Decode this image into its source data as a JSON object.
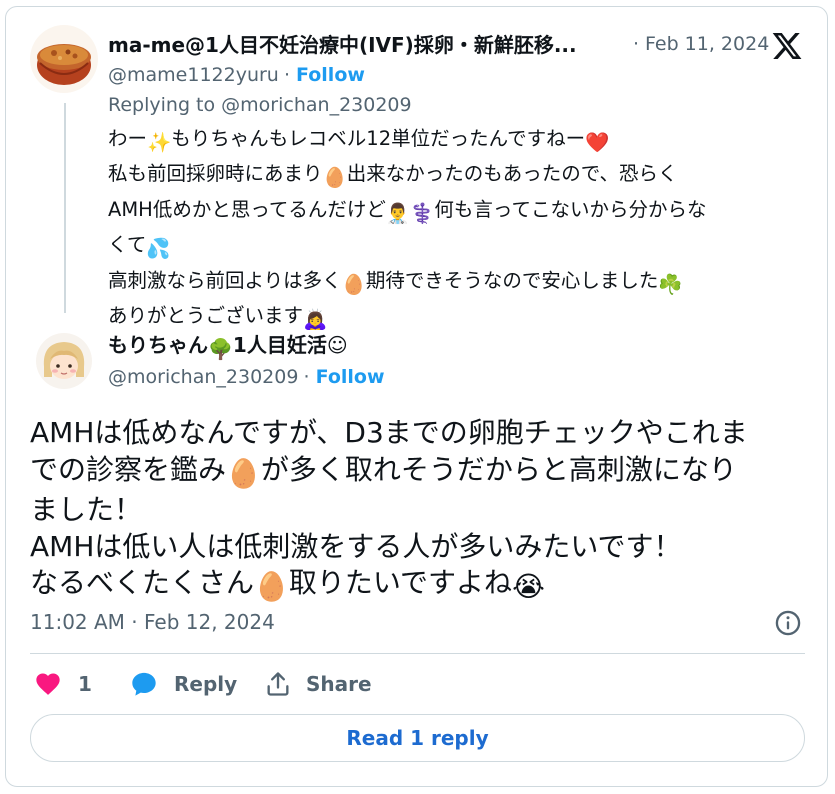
{
  "reply_tweet": {
    "author_name": "ma-me@1人目不妊治療中(IVF)採卵・新鮮胚移...",
    "date": "Feb 11, 2024",
    "handle": "@mame1122yuru",
    "follow_label": "Follow",
    "replying_to_prefix": "Replying to",
    "replying_to_handle": "@morichan_230209",
    "lines": [
      [
        "わー",
        "✨",
        "もりちゃんもレコベル12単位だったんですねー",
        "❤️"
      ],
      [
        "私も前回採卵時にあまり",
        "🥚",
        "出来なかったのもあったので、恐らく"
      ],
      [
        "AMH低めかと思ってるんだけど",
        "👨‍⚕️",
        "⚕️",
        "何も言ってこないから分からな"
      ],
      [
        "くて",
        "💦"
      ],
      [
        "高刺激なら前回よりは多く",
        "🥚",
        "期待できそうなので安心しました",
        "☘️"
      ],
      [
        "ありがとうございます",
        "🙇‍♀️"
      ]
    ]
  },
  "main_tweet": {
    "author_name": "もりちゃん",
    "author_emoji": "🌳",
    "author_name_suffix": "1人目妊活",
    "author_symbol": "☺",
    "handle": "@morichan_230209",
    "follow_label": "Follow",
    "lines": [
      [
        "AMHは低めなんですが、D3までの卵胞チェックやこれま"
      ],
      [
        "での診察を鑑み",
        "🥚",
        "が多く取れそうだからと高刺激になり"
      ],
      [
        "ました！"
      ],
      [
        "AMHは低い人は低刺激をする人が多いみたいです！"
      ],
      [
        "なるべくたくさん",
        "🥚",
        "取りたいですよね",
        "😭"
      ]
    ],
    "timestamp": "11:02 AM · Feb 12, 2024",
    "like_count": "1",
    "reply_label": "Reply",
    "share_label": "Share",
    "read_replies_label": "Read 1 reply"
  },
  "icons": {
    "logo": "x-logo-icon",
    "info": "info-icon",
    "like": "heart-icon",
    "reply": "reply-bubble-icon",
    "share": "share-icon"
  },
  "colors": {
    "link": "#1d9bf0",
    "read_reply": "#1d6bd0",
    "heart": "#f91880",
    "text": "#0f1419",
    "secondary": "#536471",
    "border": "#cfd9de"
  }
}
